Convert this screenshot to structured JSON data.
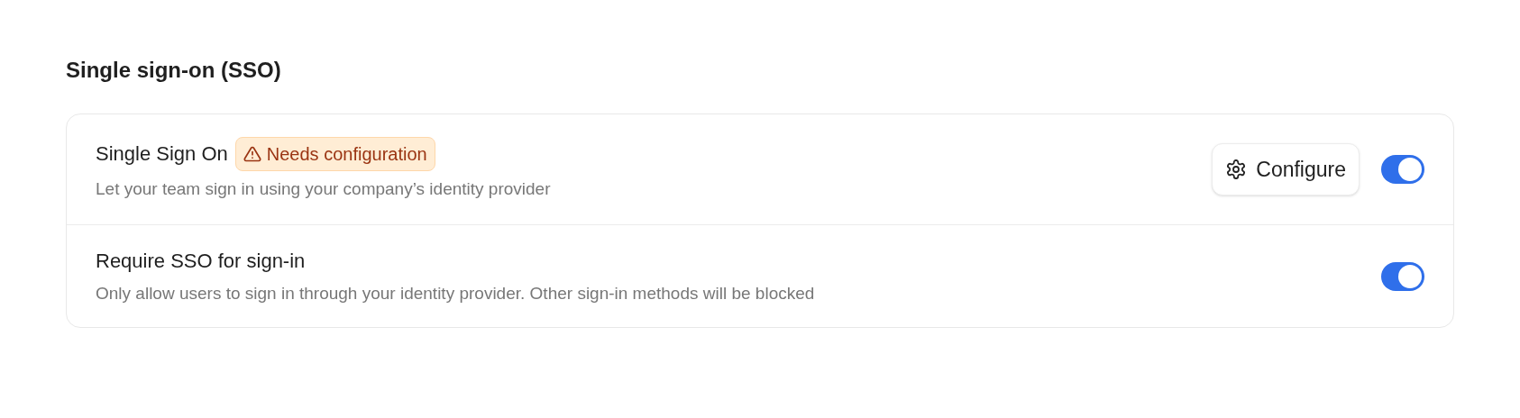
{
  "section_title": "Single sign-on (SSO)",
  "settings": [
    {
      "title": "Single Sign On",
      "badge": {
        "text": "Needs configuration"
      },
      "description": "Let your team sign in using your company’s identity provider",
      "button": {
        "label": "Configure"
      },
      "on": true
    },
    {
      "title": "Require SSO for sign-in",
      "description": "Only allow users to sign in through your identity provider. Other sign-in methods will be blocked",
      "on": true
    }
  ]
}
